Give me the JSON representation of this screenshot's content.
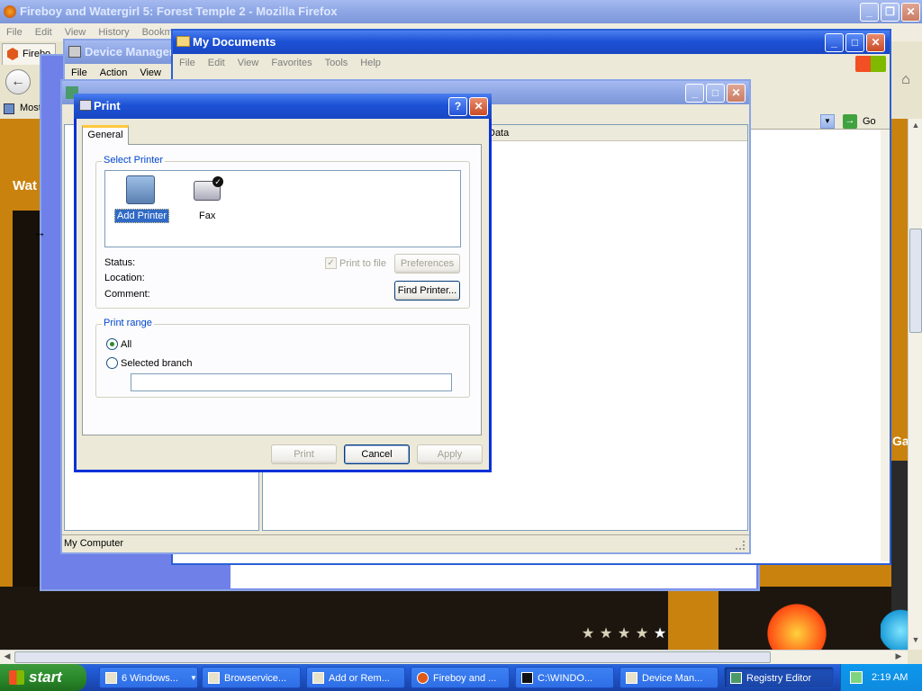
{
  "firefox": {
    "title": "Fireboy and Watergirl 5: Forest Temple 2 - Mozilla Firefox",
    "menu": [
      "File",
      "Edit",
      "View",
      "History",
      "Bookm"
    ],
    "tab_label": "Firebo",
    "bookmark": "Most",
    "page_text_left": "Wat",
    "page_text_right": "Ga"
  },
  "device_manager": {
    "title": "Device Manager",
    "menu": [
      "File",
      "Action",
      "View"
    ]
  },
  "my_documents": {
    "title": "My Documents",
    "menu": [
      "File",
      "Edit",
      "View",
      "Favorites",
      "Tools",
      "Help"
    ],
    "go_label": "Go"
  },
  "registry_editor": {
    "title": "Registry Editor",
    "column_data": "Data",
    "status": "My Computer"
  },
  "print_dialog": {
    "title": "Print",
    "help_label": "?",
    "tab_general": "General",
    "select_printer_label": "Select Printer",
    "printers": [
      {
        "name": "Add Printer",
        "selected": true
      },
      {
        "name": "Fax",
        "selected": false
      }
    ],
    "status_label": "Status:",
    "location_label": "Location:",
    "comment_label": "Comment:",
    "print_to_file_label": "Print to file",
    "print_to_file_checked": true,
    "preferences_label": "Preferences",
    "find_printer_label": "Find Printer...",
    "print_range_label": "Print range",
    "range_all_label": "All",
    "range_all_selected": true,
    "range_selected_branch_label": "Selected branch",
    "branch_value": "",
    "print_button": "Print",
    "cancel_button": "Cancel",
    "apply_button": "Apply"
  },
  "taskbar": {
    "start_label": "start",
    "items": [
      {
        "label": "6 Windows...",
        "active": false
      },
      {
        "label": "Browservice...",
        "active": false
      },
      {
        "label": "Add or Rem...",
        "active": false
      },
      {
        "label": "Fireboy and ...",
        "active": false
      },
      {
        "label": "C:\\WINDO...",
        "active": false
      },
      {
        "label": "Device Man...",
        "active": false
      },
      {
        "label": "Registry Editor",
        "active": true
      }
    ],
    "clock": "2:19 AM"
  },
  "game": {
    "stars_filled": 4,
    "stars_total": 5
  },
  "colors": {
    "xp_blue": "#1d52d6",
    "selection": "#316ac5",
    "dialog_bg": "#ece9d8"
  }
}
